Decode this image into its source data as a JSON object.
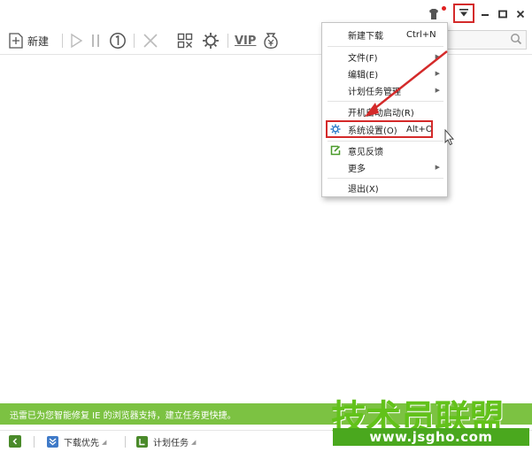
{
  "toolbar": {
    "new_label": "新建",
    "vip_label": "VIP"
  },
  "status_message": "迅雷已为您智能修复 IE 的浏览器支持，建立任务更快捷。",
  "bottom_bar": {
    "download_priority": "下载优先",
    "scheduled_tasks": "计划任务"
  },
  "menu": {
    "items": [
      {
        "label": "新建下载",
        "shortcut": "Ctrl+N"
      },
      {
        "label": "文件(F)",
        "submenu": true
      },
      {
        "label": "编辑(E)",
        "submenu": true
      },
      {
        "label": "计划任务管理",
        "submenu": true
      },
      {
        "label": "开机自动启动(R)"
      },
      {
        "label": "系统设置(O)",
        "shortcut": "Alt+O",
        "icon": "gear-icon"
      },
      {
        "label": "意见反馈",
        "icon": "edit-icon"
      },
      {
        "label": "更多",
        "submenu": true
      },
      {
        "label": "退出(X)"
      }
    ],
    "submenu_arrow": "▶"
  },
  "watermark": {
    "title": "技术员联盟",
    "url": "www.jsgho.com"
  },
  "colors": {
    "annotation_red": "#d42a2a",
    "status_green": "#7cc242",
    "watermark_green": "#62c21a",
    "gear_blue": "#2a7ac8"
  }
}
